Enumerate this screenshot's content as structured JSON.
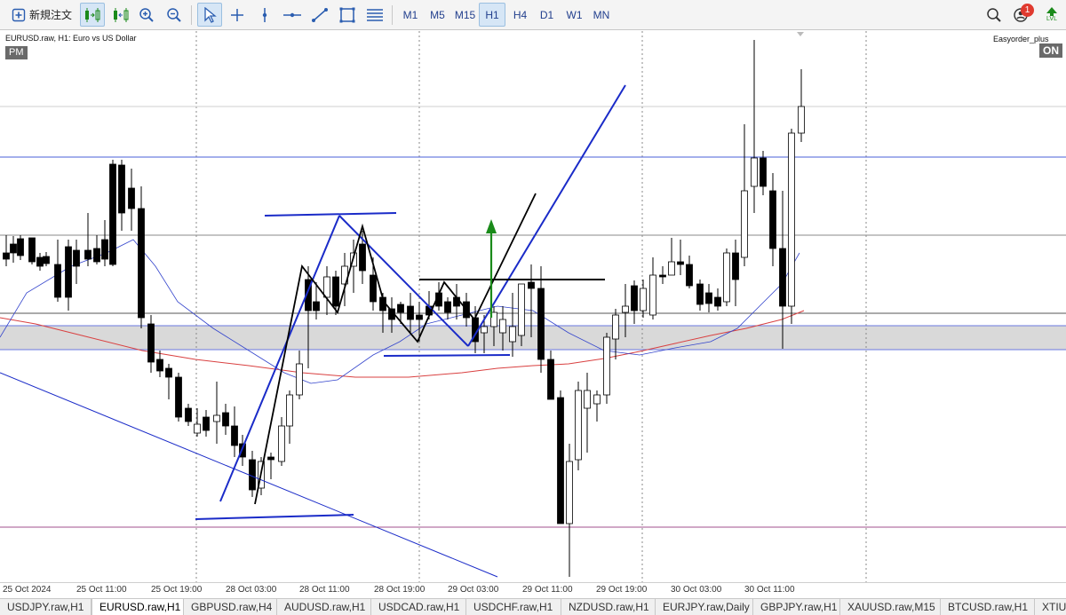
{
  "toolbar": {
    "new_order_label": "新規注文",
    "timeframes": [
      "M1",
      "M5",
      "M15",
      "H1",
      "H4",
      "D1",
      "W1",
      "MN"
    ],
    "active_timeframe": "H1",
    "notification_count": "1",
    "lvl_label": "LVL"
  },
  "chart": {
    "symbol_title": "EURUSD.raw, H1:  Euro vs US Dollar",
    "pm_label": "PM",
    "ea_name": "Easyorder_plus",
    "ea_status": "ON",
    "time_labels": [
      "25 Oct 2024",
      "25 Oct 11:00",
      "25 Oct 19:00",
      "28 Oct 03:00",
      "28 Oct 11:00",
      "28 Oct 19:00",
      "29 Oct 03:00",
      "29 Oct 11:00",
      "29 Oct 19:00",
      "30 Oct 03:00",
      "30 Oct 11:00"
    ],
    "colors": {
      "bull_body": "#ffffff",
      "bear_body": "#000000",
      "ma_fast": "#3344cc",
      "ma_slow": "#d94040",
      "trendline": "#1a2bc8",
      "arrow": "#1a8a1a",
      "zone": "#d9d9d9"
    }
  },
  "tabs": [
    "USDJPY.raw,H1",
    "EURUSD.raw,H1",
    "GBPUSD.raw,H4",
    "AUDUSD.raw,H1",
    "USDCAD.raw,H1",
    "USDCHF.raw,H1",
    "NZDUSD.raw,H1",
    "EURJPY.raw,Daily",
    "GBPJPY.raw,H1",
    "XAUUSD.raw,M15",
    "BTCUSD.raw,H1",
    "XTIU"
  ],
  "active_tab": "EURUSD.raw,H1"
}
